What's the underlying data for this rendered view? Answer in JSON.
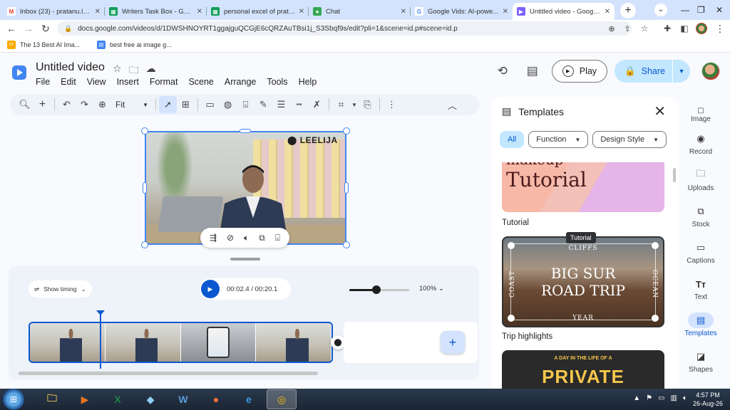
{
  "browser": {
    "tabs": [
      {
        "title": "Inbox (23) - pratanu.le...",
        "icon_text": "M",
        "color": "#ea4335"
      },
      {
        "title": "Writers Task Box - Goo...",
        "icon_text": "▦",
        "color": "#0f9d58"
      },
      {
        "title": "personal excel of prata...",
        "icon_text": "▦",
        "color": "#0f9d58"
      },
      {
        "title": "Chat",
        "icon_text": "●",
        "color": "#34a853"
      },
      {
        "title": "Google Vids: AI-powe...",
        "icon_text": "G",
        "color": "#4285f4"
      },
      {
        "title": "Untitled video - Google...",
        "icon_text": "▶",
        "color": "#7b61ff"
      }
    ],
    "url": "docs.google.com/videos/d/1DWSHNOYRT1ggajguQCGjE6cQRZAuTBsi1j_S3Sbqf9s/edit?pli=1&scene=id.p#scene=id.p",
    "bookmarks": [
      {
        "label": "The 13 Best AI Ima...",
        "icon_text": "cr",
        "color": "#f9ab00"
      },
      {
        "label": "best free ai image g...",
        "icon_text": "▤",
        "color": "#4285f4"
      }
    ]
  },
  "app": {
    "title": "Untitled video",
    "menu": [
      "File",
      "Edit",
      "View",
      "Insert",
      "Format",
      "Scene",
      "Arrange",
      "Tools",
      "Help"
    ],
    "play_label": "Play",
    "share_label": "Share",
    "zoom_fit": "Fit",
    "toolbar_icons": [
      "search-icon",
      "add-icon",
      "undo-icon",
      "redo-icon",
      "zoom-icon",
      "select-icon",
      "text-box-icon",
      "image-icon",
      "paint-icon",
      "format-paint-icon",
      "pen-icon",
      "line-weight-icon",
      "line-dash-icon",
      "clear-format-icon",
      "crop-icon",
      "replace-image-icon",
      "more-icon",
      "collapse-icon"
    ]
  },
  "canvas": {
    "watermark": "LEELIJA"
  },
  "timeline": {
    "show_timing": "Show timing",
    "time": "00:02.4 / 00:20.1",
    "zoom": "100%",
    "zoom_level": 0.45
  },
  "templates": {
    "title": "Templates",
    "chips": [
      "All",
      "Function",
      "Design Style"
    ],
    "card1_partial": "makeup",
    "card1_big": "Tutorial",
    "card1_label": "Tutorial",
    "tooltip": "Tutorial",
    "card2_top": "CLIFFS",
    "card2_big_line1": "BIG SUR",
    "card2_big_line2": "ROAD TRIP",
    "card2_left": "COAST",
    "card2_right": "OCEAN",
    "card2_bottom": "YEAR",
    "card2_label": "Trip highlights",
    "card3_small": "A DAY IN THE LIFE OF A",
    "card3_big": "PRIVATE"
  },
  "rail": [
    {
      "label": "Image",
      "icon": "image-icon"
    },
    {
      "label": "Record",
      "icon": "record-icon"
    },
    {
      "label": "Uploads",
      "icon": "folder-icon"
    },
    {
      "label": "Stock",
      "icon": "stock-icon"
    },
    {
      "label": "Captions",
      "icon": "captions-icon"
    },
    {
      "label": "Text",
      "icon": "text-icon"
    },
    {
      "label": "Templates",
      "icon": "templates-icon"
    },
    {
      "label": "Shapes",
      "icon": "shapes-icon"
    }
  ],
  "taskbar": {
    "time": "4:57 PM",
    "date": "26-Aug-26"
  }
}
